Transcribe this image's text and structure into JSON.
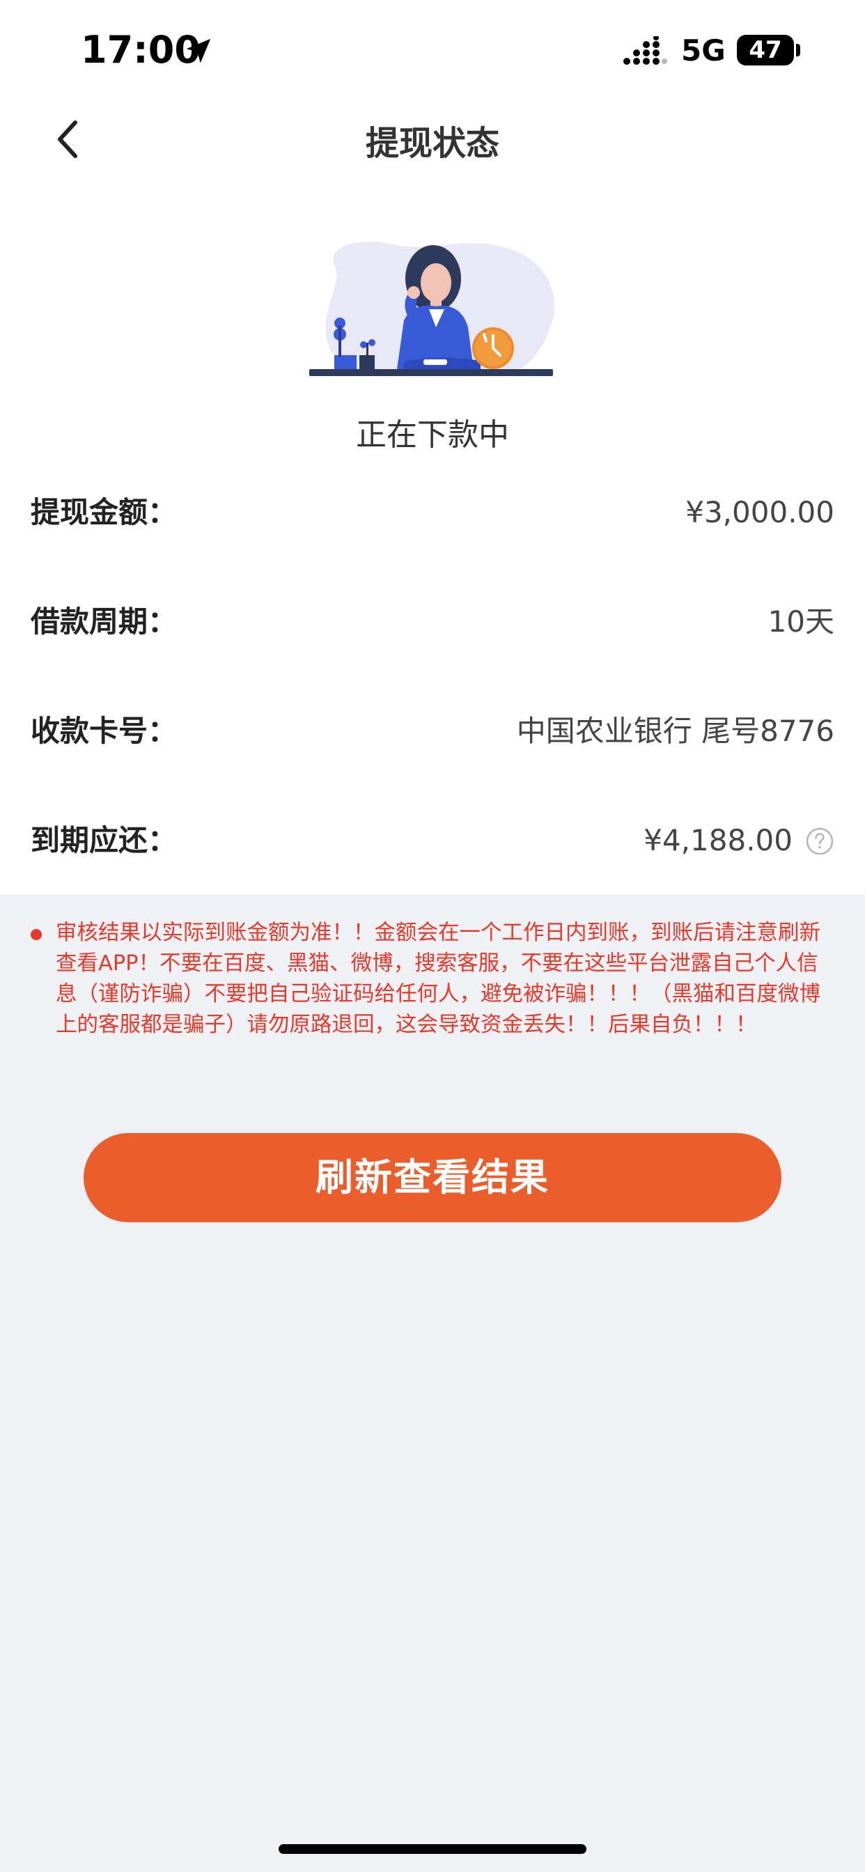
{
  "status_bar": {
    "time": "17:00",
    "network": "5G",
    "battery": "47",
    "icons": [
      "location-arrow-icon",
      "signal-icon"
    ]
  },
  "nav": {
    "title": "提现状态",
    "back_icon": "chevron-left-icon"
  },
  "status": {
    "text": "正在下款中",
    "illustration": "woman-waiting-clock-illustration"
  },
  "info": [
    {
      "label": "提现金额：",
      "value": "¥3,000.00"
    },
    {
      "label": "借款周期：",
      "value": "10天"
    },
    {
      "label": "收款卡号：",
      "value": "中国农业银行 尾号8776"
    },
    {
      "label": "到期应还：",
      "value": "¥4,188.00",
      "icon": "question-circle-icon"
    }
  ],
  "notice": {
    "text": "审核结果以实际到账金额为准！！金额会在一个工作日内到账，到账后请注意刷新查看APP！不要在百度、黑猫、微博，搜索客服，不要在这些平台泄露自己个人信息（谨防诈骗）不要把自己验证码给任何人，避免被诈骗！！！（黑猫和百度微博上的客服都是骗子）请勿原路退回，这会导致资金丢失！！后果自负！！！",
    "color": "#e53a2b"
  },
  "actions": {
    "refresh_label": "刷新查看结果",
    "button_color": "#e95e2c"
  }
}
